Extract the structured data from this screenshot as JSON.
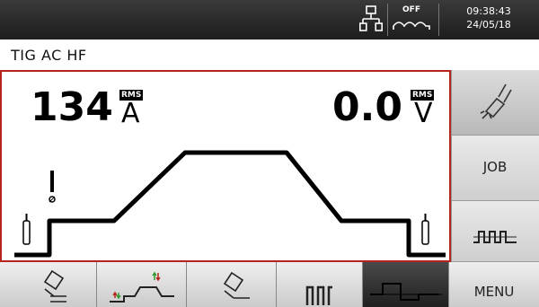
{
  "status": {
    "off_label": "OFF",
    "time": "09:38:43",
    "date": "24/05/18"
  },
  "process": {
    "label": "TIG AC HF"
  },
  "readouts": {
    "current_value": "134",
    "current_unit": "A",
    "current_tag": "RMS",
    "voltage_value": "0.0",
    "voltage_unit": "V",
    "voltage_tag": "RMS"
  },
  "side_buttons": [
    {
      "icon": "torch-spatter-icon",
      "label": ""
    },
    {
      "icon": "",
      "label": "JOB"
    },
    {
      "icon": "ac-square-wave-icon",
      "label": ""
    }
  ],
  "bottom_tabs": [
    {
      "icon": "torch-trigger-icon"
    },
    {
      "icon": "up-down-slope-icon"
    },
    {
      "icon": "torch-icon"
    },
    {
      "icon": "pulse-icon"
    },
    {
      "icon": "ac-wave-icon"
    },
    {
      "label": "MENU"
    }
  ],
  "colors": {
    "accent_red": "#b5251d",
    "green": "#2f9a2f"
  }
}
